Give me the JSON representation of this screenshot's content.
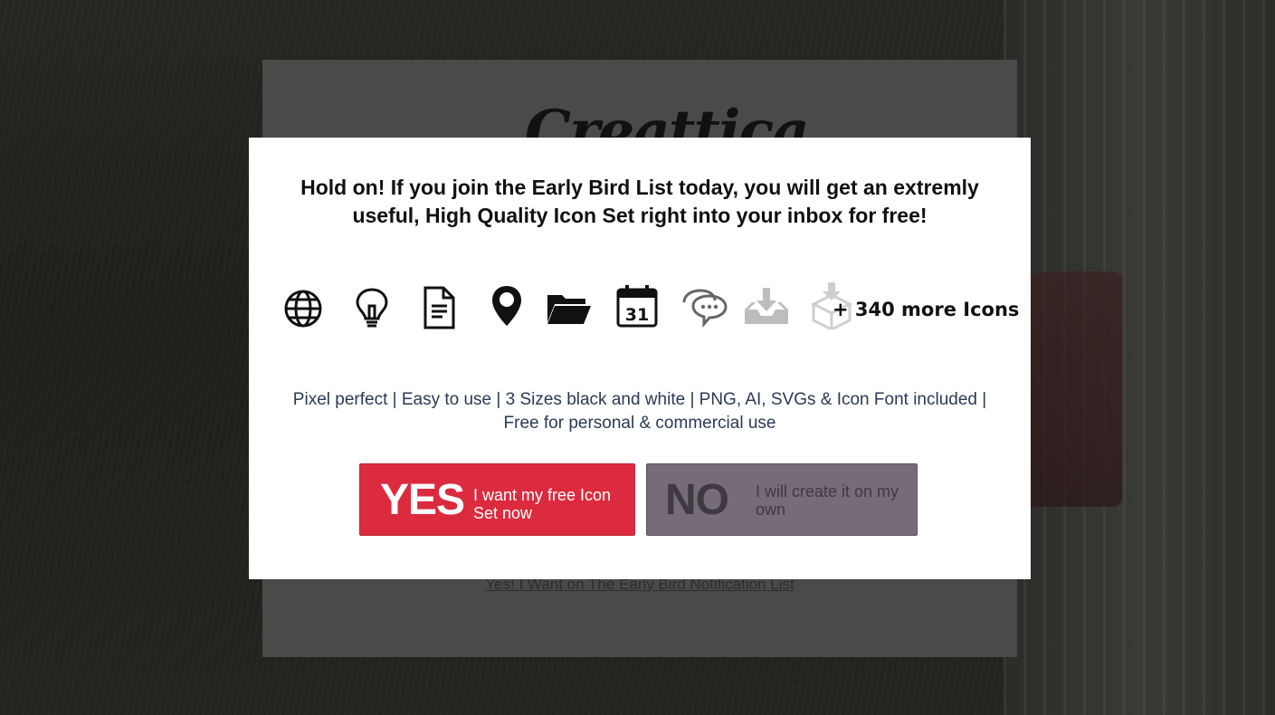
{
  "background": {
    "logo_text": "Creattica",
    "link_text": "Yes! I Want on The Early Bird Notification List"
  },
  "modal": {
    "headline": "Hold on! If you join the Early Bird List today, you will get an extremly useful, High Quality Icon Set right into your inbox for free!",
    "icons": [
      "globe-icon",
      "lightbulb-icon",
      "document-icon",
      "map-pin-icon",
      "folder-icon",
      "calendar-icon",
      "chat-icon",
      "inbox-download-icon",
      "box-download-icon"
    ],
    "calendar_day": "31",
    "more_label": "+ 340 more Icons",
    "features": "Pixel perfect | Easy to use | 3 Sizes black and white | PNG, AI, SVGs & Icon Font included | Free for personal & commercial use",
    "yes_button": {
      "big": "YES",
      "small": "I want my free Icon Set now"
    },
    "no_button": {
      "big": "NO",
      "small": "I will create it on my own"
    }
  },
  "colors": {
    "yes": "#dc2b3e",
    "no": "#766b79",
    "features_text": "#2a3a55"
  }
}
